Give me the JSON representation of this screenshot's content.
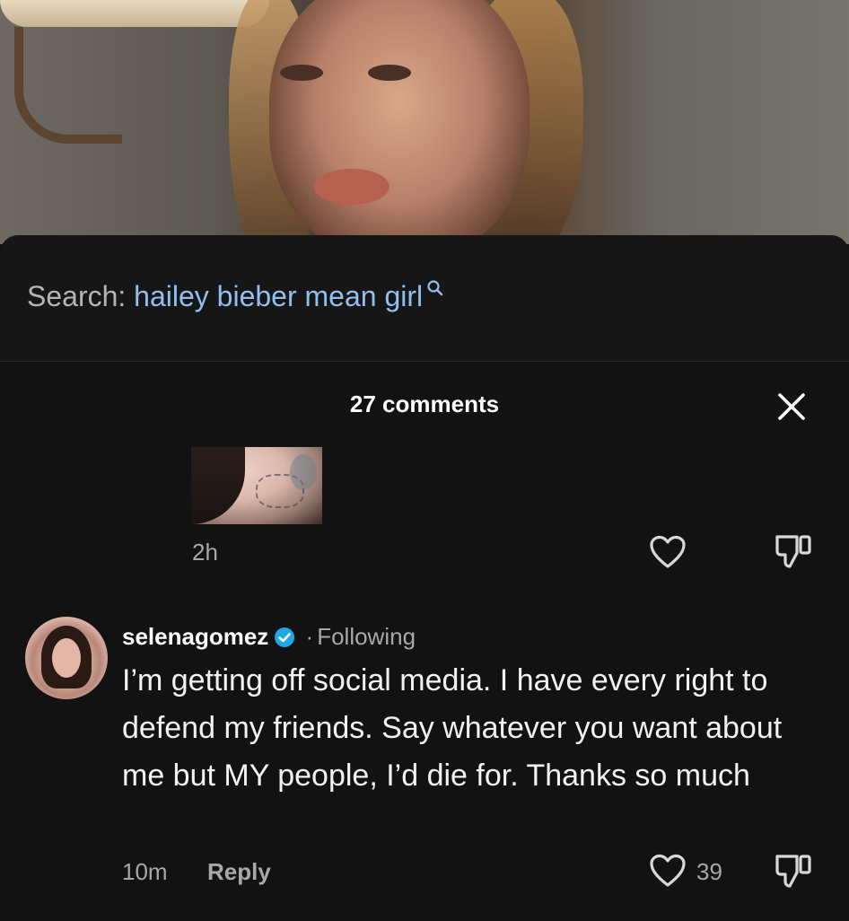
{
  "search": {
    "prefix": "Search:",
    "query": "hailey bieber mean girl",
    "icon": "search-icon"
  },
  "comments_header": {
    "count_label": "27 comments",
    "close_icon": "close-icon"
  },
  "comments": [
    {
      "attachment": "image",
      "time": "2h",
      "like_icon": "heart-icon",
      "dislike_icon": "thumbs-down-icon"
    },
    {
      "username": "selenagomez",
      "verified": true,
      "separator": "·",
      "relationship": "Following",
      "text": "I’m getting off social media. I have every right to defend my friends. Say whatever you want about me but MY people, I’d die for. Thanks so much",
      "time": "10m",
      "reply_label": "Reply",
      "likes": "39",
      "like_icon": "heart-icon",
      "dislike_icon": "thumbs-down-icon"
    }
  ],
  "colors": {
    "background": "#121212",
    "search_query": "#93bef0",
    "muted_text": "#a8a8a8",
    "verified_badge": "#20a8e6"
  }
}
